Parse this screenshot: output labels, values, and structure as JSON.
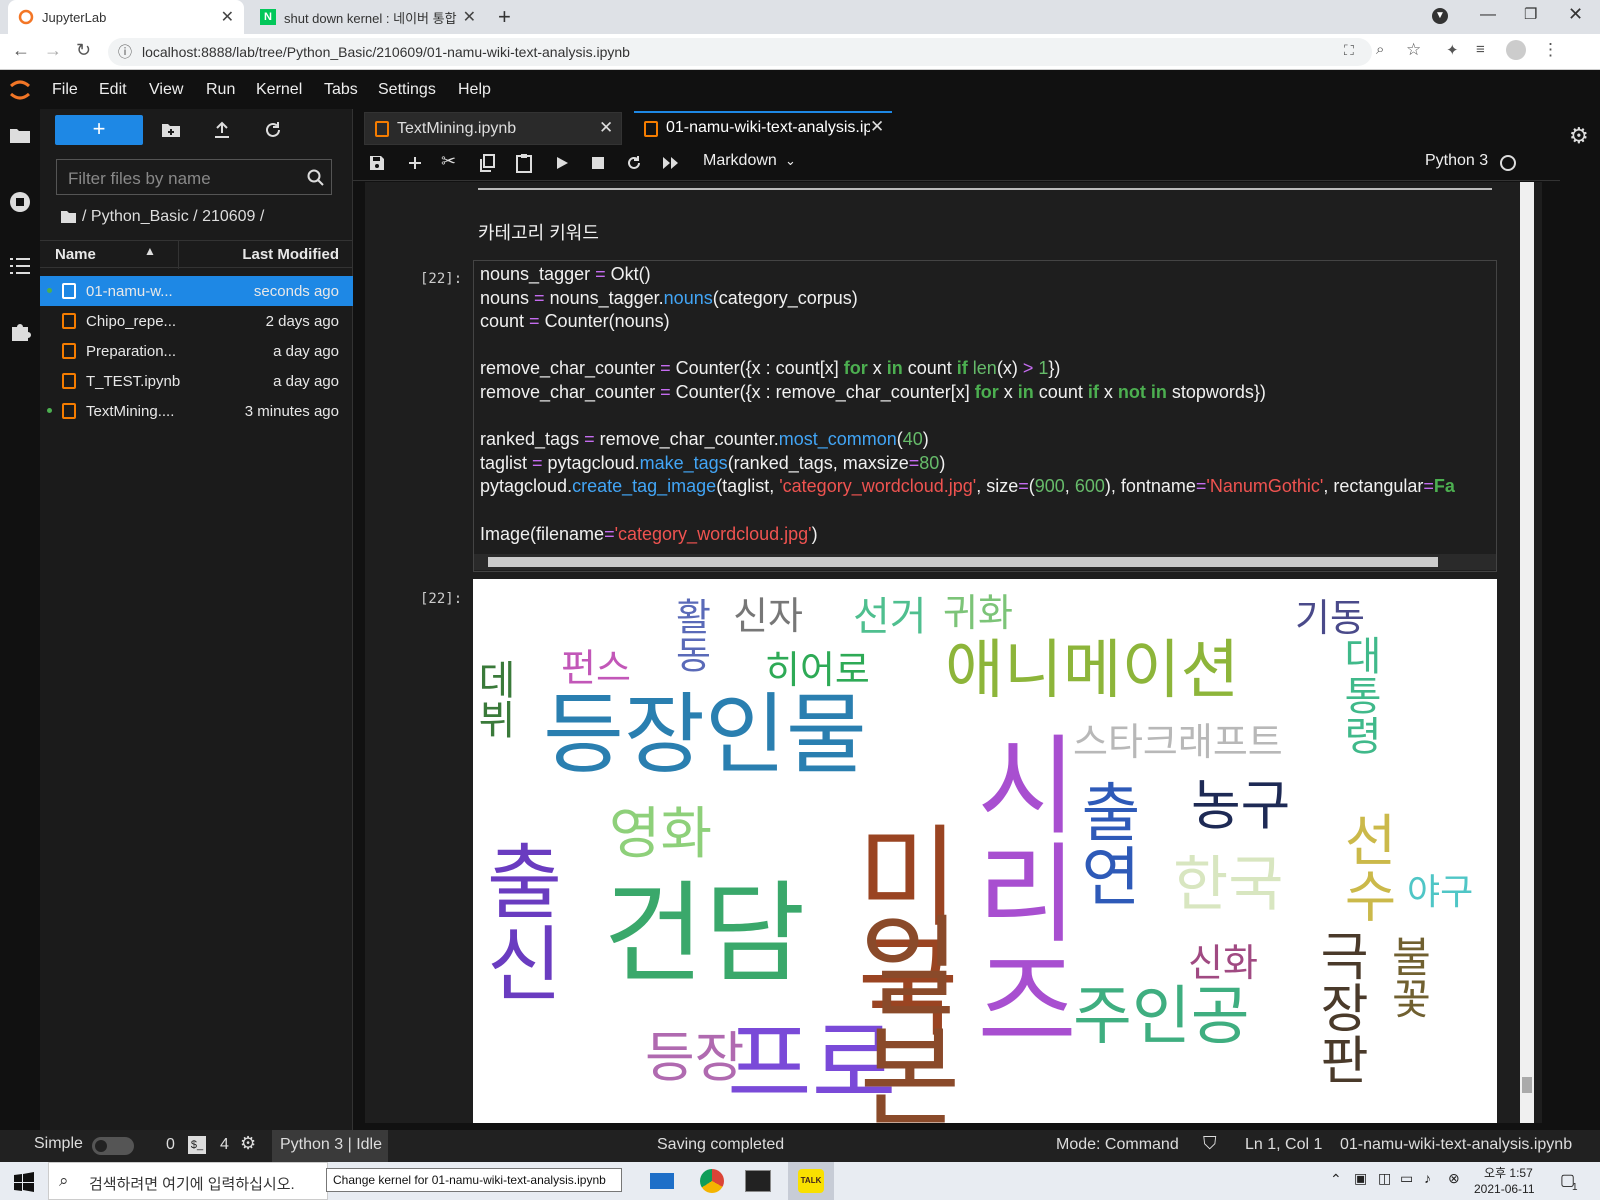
{
  "browser": {
    "tabs": [
      {
        "title": "JupyterLab",
        "active": true
      },
      {
        "title": "shut down kernel : 네이버 통합",
        "active": false
      }
    ],
    "url": "localhost:8888/lab/tree/Python_Basic/210609/01-namu-wiki-text-analysis.ipynb"
  },
  "menu": [
    "File",
    "Edit",
    "View",
    "Run",
    "Kernel",
    "Tabs",
    "Settings",
    "Help"
  ],
  "filebrowser": {
    "filter_placeholder": "Filter files by name",
    "path": "/ Python_Basic / 210609 /",
    "col_name": "Name",
    "col_modified": "Last Modified",
    "files": [
      {
        "name": "01-namu-w...",
        "modified": "seconds ago",
        "selected": true,
        "running": true
      },
      {
        "name": "Chipo_repe...",
        "modified": "2 days ago",
        "selected": false,
        "running": false
      },
      {
        "name": "Preparation...",
        "modified": "a day ago",
        "selected": false,
        "running": false
      },
      {
        "name": "T_TEST.ipynb",
        "modified": "a day ago",
        "selected": false,
        "running": false
      },
      {
        "name": "TextMining....",
        "modified": "3 minutes ago",
        "selected": false,
        "running": true
      }
    ]
  },
  "doctabs": [
    {
      "title": "TextMining.ipynb",
      "active": false
    },
    {
      "title": "01-namu-wiki-text-analysis.ip",
      "active": true
    }
  ],
  "toolbar": {
    "cell_type": "Markdown",
    "kernel": "Python 3"
  },
  "notebook": {
    "markdown_heading": "카테고리 키워드",
    "prompt_in": "[22]:",
    "prompt_out": "[22]:",
    "code_lines": [
      [
        [
          "nouns_tagger ",
          ""
        ],
        [
          "= ",
          "op"
        ],
        [
          "Okt()",
          ""
        ]
      ],
      [
        [
          "nouns ",
          ""
        ],
        [
          "= ",
          "op"
        ],
        [
          "nouns_tagger.",
          ""
        ],
        [
          "nouns",
          "fn"
        ],
        [
          "(category_corpus)",
          ""
        ]
      ],
      [
        [
          "count ",
          ""
        ],
        [
          "= ",
          "op"
        ],
        [
          "Counter(nouns)",
          ""
        ]
      ],
      [],
      [
        [
          "remove_char_counter ",
          ""
        ],
        [
          "= ",
          "op"
        ],
        [
          "Counter({x : count[x] ",
          ""
        ],
        [
          "for",
          "kw"
        ],
        [
          " x ",
          ""
        ],
        [
          "in",
          "kw"
        ],
        [
          " count ",
          ""
        ],
        [
          "if",
          "kw"
        ],
        [
          " ",
          ""
        ],
        [
          "len",
          "nm"
        ],
        [
          "(x) ",
          ""
        ],
        [
          "> ",
          "op"
        ],
        [
          "1",
          "nm"
        ],
        [
          "})",
          ""
        ]
      ],
      [
        [
          "remove_char_counter ",
          ""
        ],
        [
          "= ",
          "op"
        ],
        [
          "Counter({x : remove_char_counter[x] ",
          ""
        ],
        [
          "for",
          "kw"
        ],
        [
          " x ",
          ""
        ],
        [
          "in",
          "kw"
        ],
        [
          " count ",
          ""
        ],
        [
          "if",
          "kw"
        ],
        [
          " x ",
          ""
        ],
        [
          "not",
          "kw"
        ],
        [
          " ",
          ""
        ],
        [
          "in",
          "kw"
        ],
        [
          " stopwords})",
          ""
        ]
      ],
      [],
      [
        [
          "ranked_tags ",
          ""
        ],
        [
          "= ",
          "op"
        ],
        [
          "remove_char_counter.",
          ""
        ],
        [
          "most_common",
          "fn"
        ],
        [
          "(",
          ""
        ],
        [
          "40",
          "nm"
        ],
        [
          ")",
          ""
        ]
      ],
      [
        [
          "taglist ",
          ""
        ],
        [
          "= ",
          "op"
        ],
        [
          "pytagcloud.",
          ""
        ],
        [
          "make_tags",
          "fn"
        ],
        [
          "(ranked_tags, maxsize",
          ""
        ],
        [
          "=",
          "op"
        ],
        [
          "80",
          "nm"
        ],
        [
          ")",
          ""
        ]
      ],
      [
        [
          "pytagcloud.",
          ""
        ],
        [
          "create_tag_image",
          "fn"
        ],
        [
          "(taglist, ",
          ""
        ],
        [
          "'category_wordcloud.jpg'",
          "st"
        ],
        [
          ", size",
          ""
        ],
        [
          "=",
          "op"
        ],
        [
          "(",
          ""
        ],
        [
          "900",
          "nm"
        ],
        [
          ", ",
          ""
        ],
        [
          "600",
          "nm"
        ],
        [
          "), fontname",
          ""
        ],
        [
          "=",
          "op"
        ],
        [
          "'NanumGothic'",
          "st"
        ],
        [
          ", rectangular",
          ""
        ],
        [
          "=",
          "op"
        ],
        [
          "Fa",
          "kw"
        ]
      ],
      [],
      [
        [
          "Image(filename",
          ""
        ],
        [
          "=",
          "op"
        ],
        [
          "'category_wordcloud.jpg'",
          "st"
        ],
        [
          ")",
          ""
        ]
      ]
    ]
  },
  "wordcloud": [
    {
      "w": "등장인물",
      "c": "#2a7fb0"
    },
    {
      "w": "애니메이션",
      "c": "#8db53a"
    },
    {
      "w": "건담",
      "c": "#3aa86b"
    },
    {
      "w": "시리즈",
      "c": "#a84fd0"
    },
    {
      "w": "영화",
      "c": "#8ed07a"
    },
    {
      "w": "스타크래프트",
      "c": "#b8b8b8"
    },
    {
      "w": "농구",
      "c": "#1e2a55"
    },
    {
      "w": "한국",
      "c": "#d8e6c0"
    },
    {
      "w": "주인공",
      "c": "#3fae80"
    },
    {
      "w": "신화",
      "c": "#a04a82"
    },
    {
      "w": "야구",
      "c": "#4fc6c6"
    },
    {
      "w": "히어로",
      "c": "#2eaa56"
    },
    {
      "w": "펀스",
      "c": "#c257b8"
    },
    {
      "w": "신자",
      "c": "#777"
    },
    {
      "w": "선거",
      "c": "#4fbf8f"
    },
    {
      "w": "귀화",
      "c": "#7cc478"
    },
    {
      "w": "기동",
      "c": "#4a4a8a"
    },
    {
      "w": "출신",
      "c": "#6a3cc0"
    },
    {
      "w": "미국",
      "c": "#9a4422"
    },
    {
      "w": "출연",
      "c": "#2e5ab8"
    },
    {
      "w": "대통령",
      "c": "#40b98a"
    },
    {
      "w": "데뷔",
      "c": "#3a7a3a"
    },
    {
      "w": "활동",
      "c": "#5a6ab8"
    },
    {
      "w": "선수",
      "c": "#cbb94a"
    },
    {
      "w": "극장판",
      "c": "#4a3a2a"
    },
    {
      "w": "불꽃",
      "c": "#706030"
    },
    {
      "w": "프로",
      "c": "#7a4ad8"
    },
    {
      "w": "일본",
      "c": "#8a4a2a"
    },
    {
      "w": "등장",
      "c": "#b06ab0"
    }
  ],
  "status": {
    "mode_simple": "Simple",
    "zero": "0",
    "four": "4",
    "kernel_status": "Python 3 | Idle",
    "message": "Saving completed",
    "mode": "Mode: Command",
    "cursor": "Ln 1, Col 1",
    "file": "01-namu-wiki-text-analysis.ipynb"
  },
  "taskbar": {
    "search_placeholder": "검색하려면 여기에 입력하십시오.",
    "tooltip": "Change kernel for 01-namu-wiki-text-analysis.ipynb",
    "time": "오후 1:57",
    "date": "2021-06-11",
    "notif": "1",
    "kakao": "TALK"
  }
}
